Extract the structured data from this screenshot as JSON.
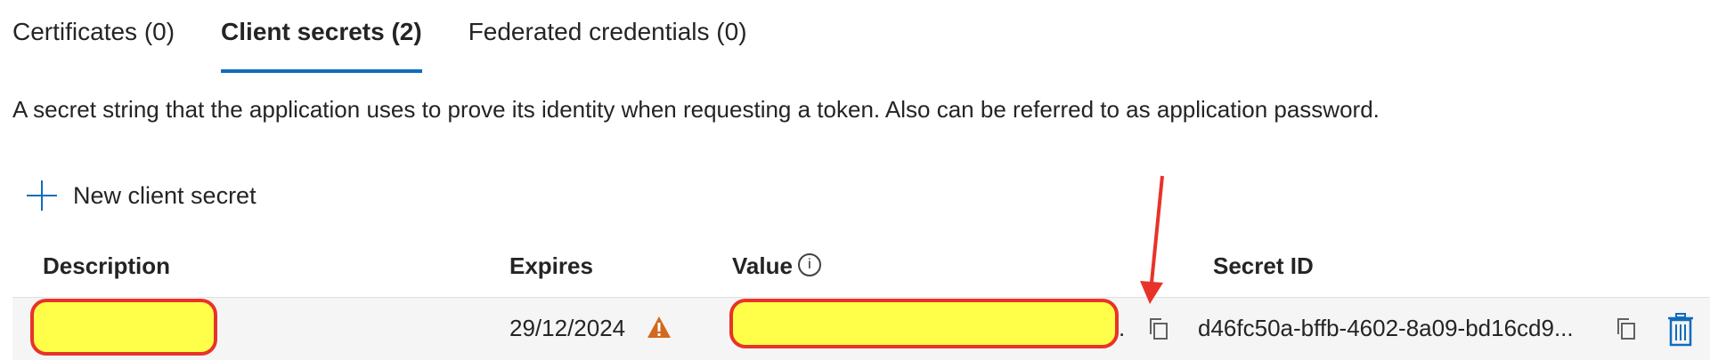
{
  "tabs": [
    {
      "label": "Certificates (0)",
      "active": false
    },
    {
      "label": "Client secrets (2)",
      "active": true
    },
    {
      "label": "Federated credentials (0)",
      "active": false
    }
  ],
  "description": "A secret string that the application uses to prove its identity when requesting a token. Also can be referred to as application password.",
  "toolbar": {
    "new_secret_label": "New client secret"
  },
  "table": {
    "headers": {
      "description": "Description",
      "expires": "Expires",
      "value": "Value",
      "secret_id": "Secret ID"
    },
    "rows": [
      {
        "description": "",
        "expires": "29/12/2024",
        "value": "",
        "value_suffix": ".",
        "secret_id": "d46fc50a-bffb-4602-8a09-bd16cd9..."
      }
    ]
  },
  "colors": {
    "accent": "#0f6cbd",
    "warning": "#d2691e",
    "redaction_fill": "#ffff4a",
    "redaction_border": "#e8332a",
    "arrow": "#e8332a"
  },
  "icons": [
    "plus-icon",
    "info-icon",
    "warning-icon",
    "copy-icon",
    "delete-icon"
  ]
}
